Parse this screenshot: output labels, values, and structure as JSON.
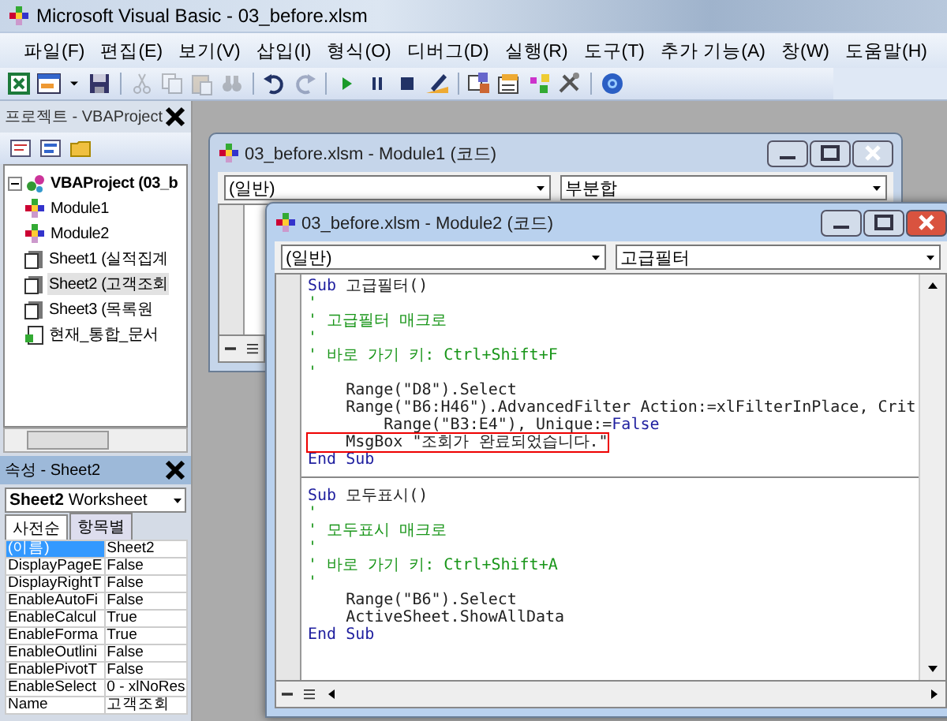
{
  "window": {
    "title": "Microsoft Visual Basic - 03_before.xlsm"
  },
  "menu": [
    "파일(F)",
    "편집(E)",
    "보기(V)",
    "삽입(I)",
    "형식(O)",
    "디버그(D)",
    "실행(R)",
    "도구(T)",
    "추가 기능(A)",
    "창(W)",
    "도움말(H)"
  ],
  "toolbar": [
    {
      "kind": "excel",
      "disabled": false
    },
    {
      "kind": "userform",
      "disabled": false
    },
    {
      "kind": "dropdown",
      "disabled": false
    },
    {
      "kind": "save",
      "disabled": false
    },
    {
      "kind": "separator"
    },
    {
      "kind": "cut",
      "disabled": true
    },
    {
      "kind": "copy",
      "disabled": true
    },
    {
      "kind": "paste",
      "disabled": true
    },
    {
      "kind": "find",
      "disabled": true
    },
    {
      "kind": "separator"
    },
    {
      "kind": "undo",
      "disabled": false
    },
    {
      "kind": "redo",
      "disabled": true
    },
    {
      "kind": "separator"
    },
    {
      "kind": "run",
      "disabled": false
    },
    {
      "kind": "pause",
      "disabled": false
    },
    {
      "kind": "stop",
      "disabled": false
    },
    {
      "kind": "design",
      "disabled": false
    },
    {
      "kind": "separator"
    },
    {
      "kind": "project",
      "disabled": false
    },
    {
      "kind": "properties",
      "disabled": false
    },
    {
      "kind": "browser",
      "disabled": false
    },
    {
      "kind": "toolbox",
      "disabled": false
    },
    {
      "kind": "separator"
    },
    {
      "kind": "help",
      "disabled": false
    }
  ],
  "project_explorer": {
    "title": "프로젝트 - VBAProject",
    "tree": [
      {
        "label": "VBAProject (03_b",
        "kind": "project",
        "expanded": true,
        "selected": false,
        "children": [
          {
            "label": "Module1",
            "kind": "module",
            "selected": false
          },
          {
            "label": "Module2",
            "kind": "module",
            "selected": false
          },
          {
            "label": "Sheet1 (실적집계",
            "kind": "sheet",
            "selected": false
          },
          {
            "label": "Sheet2 (고객조회",
            "kind": "sheet",
            "selected": true
          },
          {
            "label": "Sheet3 (목록원",
            "kind": "sheet",
            "selected": false
          },
          {
            "label": "현재_통합_문서",
            "kind": "workbook",
            "selected": false
          }
        ]
      }
    ]
  },
  "properties": {
    "title": "속성 - Sheet2",
    "object": {
      "name": "Sheet2",
      "type": "Worksheet"
    },
    "tabs": [
      {
        "label": "사전순",
        "selected": true
      },
      {
        "label": "항목별",
        "selected": false
      }
    ],
    "rows": [
      {
        "name": "(이름)",
        "value": "Sheet2",
        "selected": true
      },
      {
        "name": "DisplayPageE",
        "value": "False",
        "selected": false
      },
      {
        "name": "DisplayRightT",
        "value": "False",
        "selected": false
      },
      {
        "name": "EnableAutoFi",
        "value": "False",
        "selected": false
      },
      {
        "name": "EnableCalcul",
        "value": "True",
        "selected": false
      },
      {
        "name": "EnableForma",
        "value": "True",
        "selected": false
      },
      {
        "name": "EnableOutlini",
        "value": "False",
        "selected": false
      },
      {
        "name": "EnablePivotT",
        "value": "False",
        "selected": false
      },
      {
        "name": "EnableSelect",
        "value": "0 - xlNoRes",
        "selected": false
      },
      {
        "name": "Name",
        "value": "고객조회",
        "selected": false
      }
    ]
  },
  "code_windows": [
    {
      "title": "03_before.xlsm - Module1 (코드)",
      "active": false,
      "object_combo": "(일반)",
      "procedure_combo": "부분합"
    },
    {
      "title": "03_before.xlsm - Module2 (코드)",
      "active": true,
      "object_combo": "(일반)",
      "procedure_combo": "고급필터",
      "procedures": [
        {
          "lines": [
            {
              "tokens": [
                {
                  "text": "Sub",
                  "kind": "keyword"
                },
                {
                  "text": " 고급필터()",
                  "kind": "plain"
                }
              ]
            },
            {
              "tokens": [
                {
                  "text": "'",
                  "kind": "comment"
                }
              ]
            },
            {
              "tokens": [
                {
                  "text": "' 고급필터 매크로",
                  "kind": "comment"
                }
              ]
            },
            {
              "tokens": [
                {
                  "text": "'",
                  "kind": "comment"
                }
              ]
            },
            {
              "tokens": [
                {
                  "text": "' 바로 가기 키: Ctrl+Shift+F",
                  "kind": "comment"
                }
              ]
            },
            {
              "tokens": [
                {
                  "text": "'",
                  "kind": "comment"
                }
              ]
            },
            {
              "tokens": [
                {
                  "text": "    Range(\"D8\").Select",
                  "kind": "plain"
                }
              ]
            },
            {
              "tokens": [
                {
                  "text": "    Range(\"B6:H46\").AdvancedFilter Action:=xlFilterInPlace, Crit",
                  "kind": "plain"
                }
              ]
            },
            {
              "tokens": [
                {
                  "text": "        Range(\"B3:E4\"), Unique:=",
                  "kind": "plain"
                },
                {
                  "text": "False",
                  "kind": "keyword"
                }
              ]
            },
            {
              "tokens": [
                {
                  "text": "    MsgBox \"조회가 완료되었습니다.\"",
                  "kind": "plain"
                }
              ],
              "boxed": true
            },
            {
              "tokens": [
                {
                  "text": "End Sub",
                  "kind": "keyword"
                }
              ]
            }
          ]
        },
        {
          "lines": [
            {
              "tokens": [
                {
                  "text": "Sub",
                  "kind": "keyword"
                },
                {
                  "text": " 모두표시()",
                  "kind": "plain"
                }
              ]
            },
            {
              "tokens": [
                {
                  "text": "'",
                  "kind": "comment"
                }
              ]
            },
            {
              "tokens": [
                {
                  "text": "' 모두표시 매크로",
                  "kind": "comment"
                }
              ]
            },
            {
              "tokens": [
                {
                  "text": "'",
                  "kind": "comment"
                }
              ]
            },
            {
              "tokens": [
                {
                  "text": "' 바로 가기 키: Ctrl+Shift+A",
                  "kind": "comment"
                }
              ]
            },
            {
              "tokens": [
                {
                  "text": "'",
                  "kind": "comment"
                }
              ]
            },
            {
              "tokens": [
                {
                  "text": "    Range(\"B6\").Select",
                  "kind": "plain"
                }
              ]
            },
            {
              "tokens": [
                {
                  "text": "    ActiveSheet.ShowAllData",
                  "kind": "plain"
                }
              ]
            },
            {
              "tokens": [
                {
                  "text": "End Sub",
                  "kind": "keyword"
                }
              ]
            }
          ]
        }
      ]
    }
  ]
}
